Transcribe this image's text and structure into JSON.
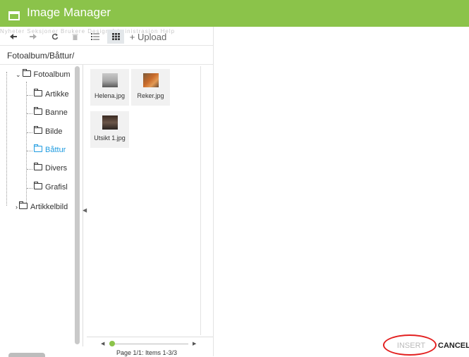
{
  "window": {
    "title": "Image Manager"
  },
  "background_menu": "Nyheter   Seksjoner   Brukere   Design   Administrasjon   Help",
  "toolbar": {
    "back_icon": "back-arrow-icon",
    "forward_icon": "forward-arrow-icon",
    "refresh_icon": "refresh-icon",
    "delete_icon": "trash-icon",
    "list_view_icon": "list-view-icon",
    "grid_view_icon": "grid-view-icon",
    "upload_label": "+ Upload"
  },
  "breadcrumb": "Fotoalbum/Båttur/",
  "tree": {
    "root": "Fotoalbum",
    "children": [
      "Artikke",
      "Banne",
      "Bilde",
      "Båttur",
      "Divers",
      "Grafisl"
    ],
    "selected": "Båttur",
    "second_root": "Artikkelbild"
  },
  "files": [
    {
      "name": "Helena.jpg"
    },
    {
      "name": "Reker.jpg"
    },
    {
      "name": "Utsikt 1.jpg"
    }
  ],
  "pager": {
    "info": "Page 1/1: Items 1-3/3"
  },
  "actions": {
    "insert": "INSERT",
    "cancel": "CANCEL"
  },
  "colors": {
    "accent": "#8bc34a",
    "selected": "#1e9be0",
    "highlight": "#e32020"
  }
}
